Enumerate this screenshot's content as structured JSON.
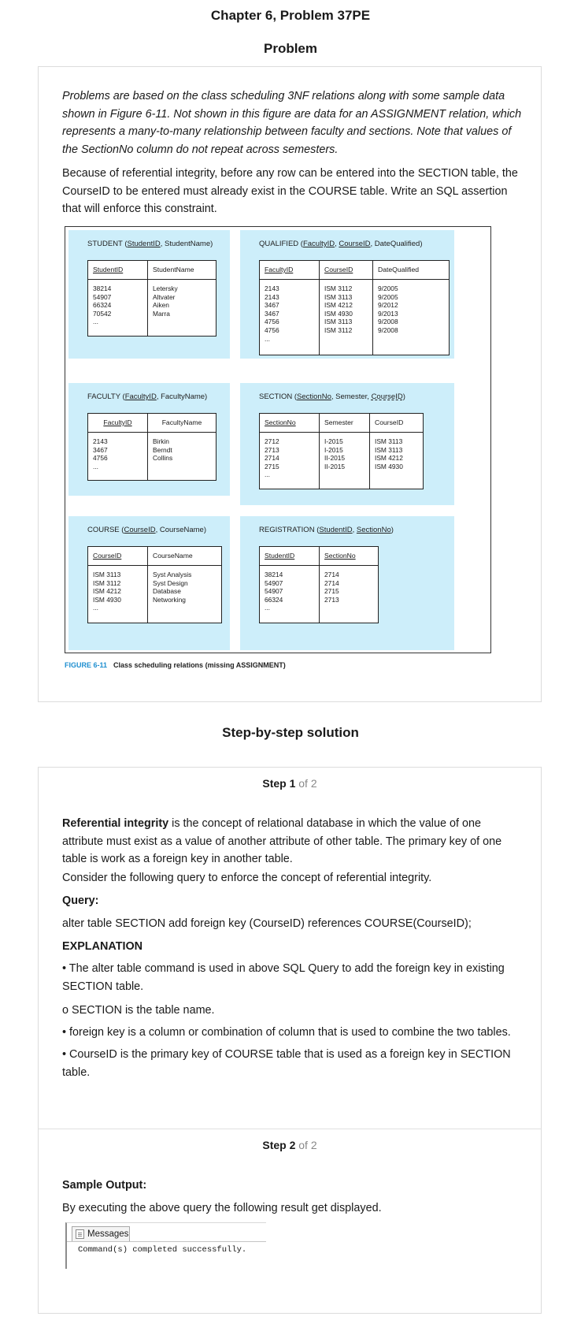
{
  "page": {
    "chapter_title": "Chapter 6, Problem 37PE",
    "problem_heading": "Problem",
    "solution_heading": "Step-by-step solution"
  },
  "problem": {
    "intro": "Problems are based on the class scheduling 3NF relations along with some sample data shown in Figure 6-11. Not shown in this figure are data for an ASSIGNMENT relation, which represents a many-to-many relationship between faculty and sections. Note that values of the SectionNo column do not repeat across semesters.",
    "question": "Because of referential integrity, before any row can be entered into the SECTION table, the CourseID to be entered must already exist in the COURSE table. Write an SQL assertion that will enforce this constraint."
  },
  "figure": {
    "caption_label": "FIGURE 6-11",
    "caption_text": "Class scheduling relations (missing ASSIGNMENT)",
    "relations": {
      "student": {
        "name": "STUDENT (",
        "key1": "StudentID",
        "rest": ", StudentName)",
        "headers": [
          "StudentID",
          "StudentName"
        ],
        "cols": [
          "38214\n54907\n66324\n70542\n...",
          "Letersky\nAltvater\nAiken\nMarra"
        ]
      },
      "qualified": {
        "name": "QUALIFIED (",
        "key1": "FacultyID",
        "sep": ", ",
        "key2": "CourseID",
        "rest": ", DateQualified)",
        "headers": [
          "FacultyID",
          "CourseID",
          "DateQualified"
        ],
        "cols": [
          "2143\n2143\n3467\n3467\n4756\n4756\n...",
          "ISM 3112\nISM 3113\nISM 4212\nISM 4930\nISM 3113\nISM 3112",
          "9/2005\n9/2005\n9/2012\n9/2013\n9/2008\n9/2008"
        ]
      },
      "faculty": {
        "name": "FACULTY (",
        "key1": "FacultyID",
        "rest": ", FacultyName)",
        "headers": [
          "FacultyID",
          "FacultyName"
        ],
        "cols": [
          "2143\n3467\n4756\n...",
          "Birkin\nBerndt\nCollins"
        ]
      },
      "section": {
        "name": "SECTION (",
        "key1": "SectionNo",
        "mid": ", Semester, ",
        "fk": "CourseID",
        "rest": ")",
        "headers": [
          "SectionNo",
          "Semester",
          "CourseID"
        ],
        "cols": [
          "2712\n2713\n2714\n2715\n...",
          "I-2015\nI-2015\nII-2015\nII-2015",
          "ISM 3113\nISM 3113\nISM 4212\nISM 4930"
        ]
      },
      "course": {
        "name": "COURSE (",
        "key1": "CourseID",
        "rest": ", CourseName)",
        "headers": [
          "CourseID",
          "CourseName"
        ],
        "cols": [
          "ISM 3113\nISM 3112\nISM 4212\nISM 4930\n...",
          "Syst Analysis\nSyst Design\nDatabase\nNetworking"
        ]
      },
      "registration": {
        "name": "REGISTRATION (",
        "key1": "StudentID",
        "sep": ", ",
        "key2": "SectionNo",
        "rest": ")",
        "headers": [
          "StudentID",
          "SectionNo"
        ],
        "cols": [
          "38214\n54907\n54907\n66324\n...",
          "2714\n2714\n2715\n2713"
        ]
      }
    }
  },
  "step1": {
    "label": "Step 1",
    "of": " of 2",
    "term": "Referential integrity",
    "definition": " is the concept of relational database in which the value of one attribute must exist as a value of another attribute of other table. The primary key of one table is work as a foreign key in another table.",
    "consider": "Consider the following query to enforce the concept of referential integrity.",
    "query_label": "Query:",
    "query": "alter table SECTION add foreign key (CourseID) references COURSE(CourseID);",
    "explanation_label": "EXPLANATION",
    "bullet1": "• The alter table command is used in above SQL Query to add the foreign key in existing SECTION table.",
    "bullet2": "o SECTION is the table name.",
    "bullet3": "• foreign key is a column or combination of column that is used to combine the two tables.",
    "bullet4": "• CourseID is the primary key of COURSE table that is used as a foreign key in SECTION table."
  },
  "step2": {
    "label": "Step 2",
    "of": " of 2",
    "sample_label": "Sample Output:",
    "text": "By executing the above query the following result get displayed.",
    "messages_tab": "Messages",
    "messages_output": "Command(s) completed successfully."
  }
}
